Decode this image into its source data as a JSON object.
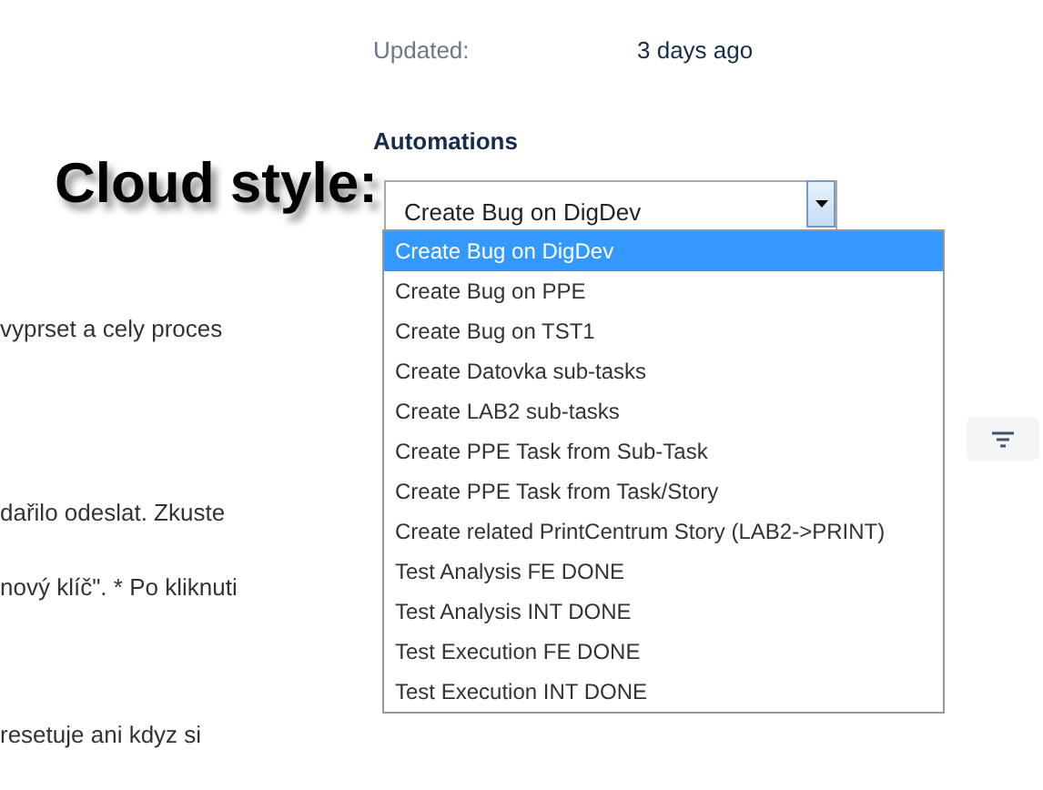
{
  "updated": {
    "label": "Updated:",
    "value": "3 days ago"
  },
  "caption": "Cloud style:",
  "automations": {
    "title": "Automations",
    "value": "Create Bug on DigDev",
    "options": [
      {
        "label": "Create Bug on DigDev",
        "selected": true
      },
      {
        "label": "Create Bug on PPE",
        "selected": false
      },
      {
        "label": "Create Bug on TST1",
        "selected": false
      },
      {
        "label": "Create Datovka sub-tasks",
        "selected": false
      },
      {
        "label": "Create LAB2 sub-tasks",
        "selected": false
      },
      {
        "label": "Create PPE Task from Sub-Task",
        "selected": false
      },
      {
        "label": "Create PPE Task from Task/Story",
        "selected": false
      },
      {
        "label": "Create related PrintCentrum Story (LAB2->PRINT)",
        "selected": false
      },
      {
        "label": "Test Analysis FE DONE",
        "selected": false
      },
      {
        "label": "Test Analysis INT DONE",
        "selected": false
      },
      {
        "label": "Test Execution FE DONE",
        "selected": false
      },
      {
        "label": "Test Execution INT DONE",
        "selected": false
      }
    ]
  },
  "background_text": [
    "vyprset a cely proces",
    "dařilo odeslat. Zkuste",
    "nový klíč\". * Po kliknuti",
    "resetuje ani kdyz si"
  ]
}
